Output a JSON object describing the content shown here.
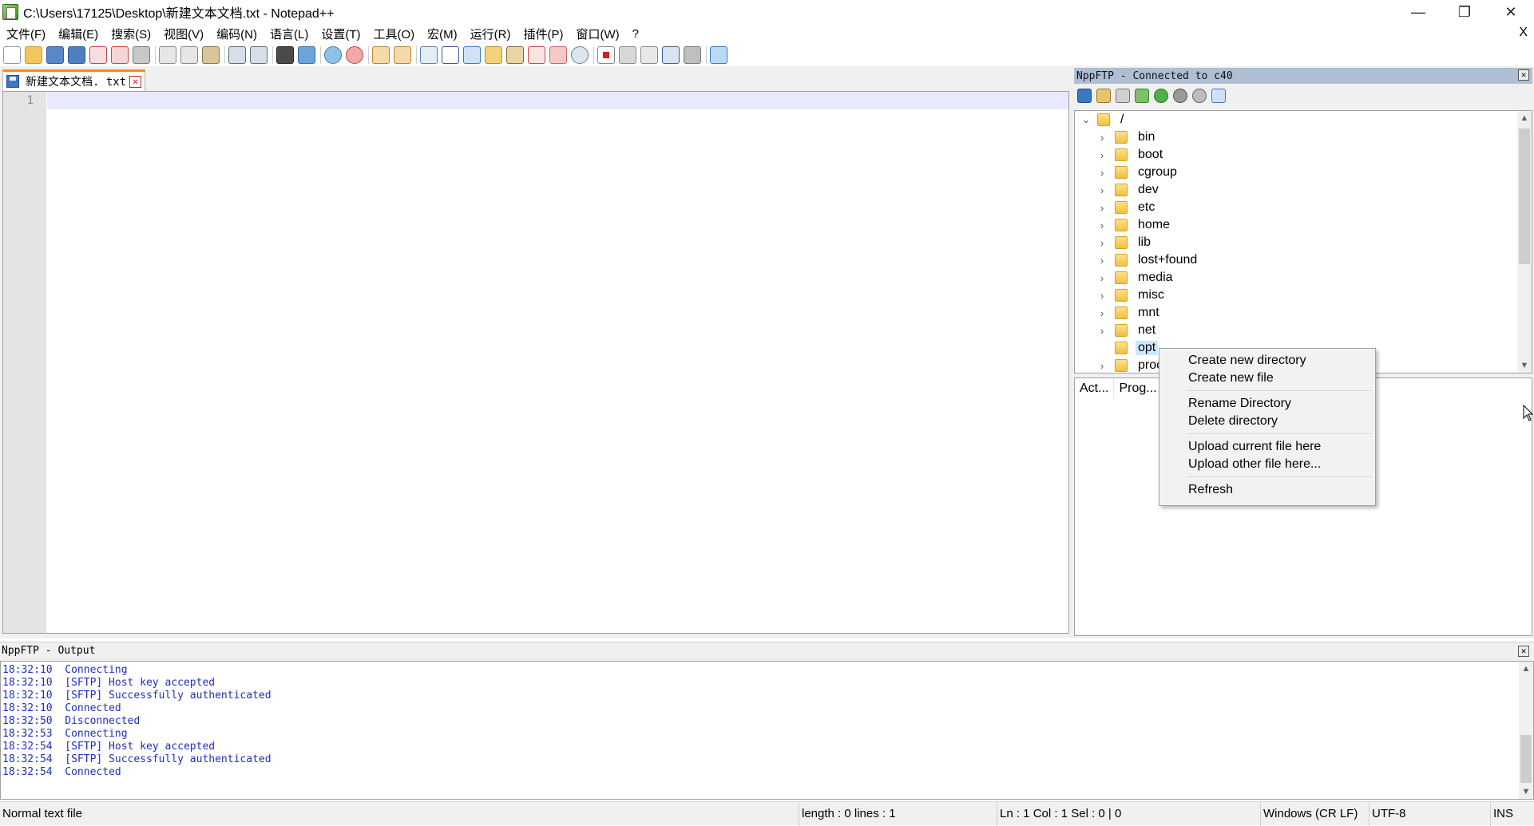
{
  "window": {
    "title": "C:\\Users\\17125\\Desktop\\新建文本文档.txt - Notepad++",
    "minimize": "—",
    "restore": "❐",
    "close": "✕"
  },
  "menu": {
    "items": [
      "文件(F)",
      "编辑(E)",
      "搜索(S)",
      "视图(V)",
      "编码(N)",
      "语言(L)",
      "设置(T)",
      "工具(O)",
      "宏(M)",
      "运行(R)",
      "插件(P)",
      "窗口(W)",
      "?"
    ],
    "close": "X"
  },
  "editor": {
    "tab_label": "新建文本文档. txt",
    "tab_close": "✕",
    "line_number": "1"
  },
  "ftp": {
    "header": "NppFTP - Connected to c40",
    "close": "✕",
    "root_label": "/",
    "tree": [
      "bin",
      "boot",
      "cgroup",
      "dev",
      "etc",
      "home",
      "lib",
      "lost+found",
      "media",
      "misc",
      "mnt",
      "net",
      "opt",
      "proc"
    ],
    "selected": "opt",
    "queue_columns": [
      "Act...",
      "Prog..."
    ]
  },
  "context_menu": {
    "items": [
      "Create new directory",
      "Create new file",
      "Rename Directory",
      "Delete directory",
      "Upload current file here",
      "Upload other file here...",
      "Refresh"
    ]
  },
  "output": {
    "header": "NppFTP - Output",
    "close": "✕",
    "lines": [
      "18:32:10  Connecting",
      "18:32:10  [SFTP] Host key accepted",
      "18:32:10  [SFTP] Successfully authenticated",
      "18:32:10  Connected",
      "18:32:50  Disconnected",
      "18:32:53  Connecting",
      "18:32:54  [SFTP] Host key accepted",
      "18:32:54  [SFTP] Successfully authenticated",
      "18:32:54  Connected"
    ]
  },
  "status": {
    "file_type": "Normal text file",
    "length": "length : 0    lines : 1",
    "position": "Ln : 1    Col : 1    Sel : 0 | 0",
    "eol": "Windows (CR LF)",
    "encoding": "UTF-8",
    "mode": "INS"
  },
  "colors": {
    "tab_accent": "#fa8a1e",
    "ftp_header_bg": "#aebfd4",
    "output_text": "#1e2fbf",
    "current_line": "#e8e8ff",
    "selection": "#cce8ff"
  },
  "icons": {
    "toolbar": [
      "new-file-icon",
      "open-file-icon",
      "save-icon",
      "save-all-icon",
      "close-icon",
      "close-all-icon",
      "print-icon",
      "cut-icon",
      "copy-icon",
      "paste-icon",
      "undo-icon",
      "redo-icon",
      "find-icon",
      "replace-icon",
      "zoom-in-icon",
      "zoom-out-icon",
      "sync-vertical-icon",
      "sync-horizontal-icon",
      "word-wrap-icon",
      "show-all-chars-icon",
      "indent-guide-icon",
      "udl-icon",
      "doc-map-icon",
      "function-list-icon",
      "folder-workspace-icon",
      "monitoring-icon",
      "record-macro-icon",
      "stop-record-icon",
      "play-macro-icon",
      "run-macro-multiple-icon",
      "save-macro-icon",
      "ftp-show-icon"
    ],
    "ftp_toolbar": [
      "connect-icon",
      "open-dir-icon",
      "download-icon",
      "upload-icon",
      "refresh-icon",
      "abort-icon",
      "settings-icon",
      "message-window-icon"
    ]
  }
}
